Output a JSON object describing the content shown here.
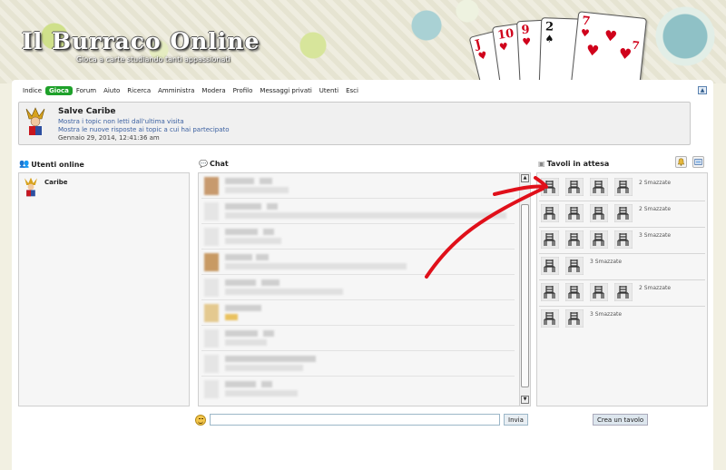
{
  "header": {
    "title": "Il Burraco Online",
    "tagline": "Gioca a carte studiando tanti appassionati",
    "cards": [
      "J",
      "10",
      "9",
      "2",
      "7",
      "7"
    ]
  },
  "nav": {
    "items": [
      "Indice",
      "Gioca",
      "Forum",
      "Aiuto",
      "Ricerca",
      "Amministra",
      "Modera",
      "Profilo",
      "Messaggi privati",
      "Utenti",
      "Esci"
    ],
    "active": "Gioca"
  },
  "welcome": {
    "greeting": "Salve Caribe",
    "link_unread": "Mostra i topic non letti dall'ultima visita",
    "link_replies": "Mostra le nuove risposte ai topic a cui hai partecipato",
    "date": "Gennaio 29, 2014, 12:41:36 am"
  },
  "users": {
    "title": "Utenti online",
    "list": [
      "Caribe"
    ]
  },
  "chat": {
    "title": "Chat",
    "messages": [
      {
        "name": "",
        "text": ""
      },
      {
        "name": "",
        "text": ""
      },
      {
        "name": "",
        "text": ""
      },
      {
        "name": "",
        "text": ""
      },
      {
        "name": "",
        "text": ""
      },
      {
        "name": "",
        "text": ""
      },
      {
        "name": "",
        "text": ""
      },
      {
        "name": "",
        "text": ""
      },
      {
        "name": "",
        "text": ""
      }
    ],
    "input_placeholder": "",
    "send_label": "Invia"
  },
  "tables": {
    "title": "Tavoli in attesa",
    "rows": [
      {
        "seats": 4,
        "label": "2 Smazzate"
      },
      {
        "seats": 4,
        "label": "2 Smazzate"
      },
      {
        "seats": 4,
        "label": "3 Smazzate"
      },
      {
        "seats": 2,
        "label": "3 Smazzate"
      },
      {
        "seats": 4,
        "label": "2 Smazzate"
      },
      {
        "seats": 2,
        "label": "3 Smazzate"
      }
    ],
    "create_label": "Crea un tavolo"
  },
  "colors": {
    "active_nav": "#1ea12a",
    "link": "#3a5fa0",
    "arrow": "#e0101a"
  }
}
